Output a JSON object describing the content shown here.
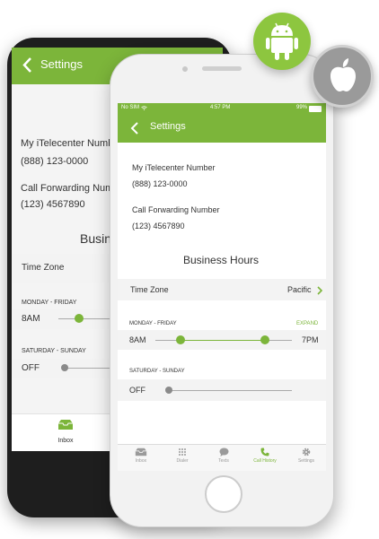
{
  "colors": {
    "brand_green": "#7cb53a",
    "accent_text_green": "#7cb53a",
    "text_dark": "#333333"
  },
  "badges": {
    "android": "android-icon",
    "apple": "apple-icon"
  },
  "android": {
    "header_title": "Settings",
    "number_label": "My iTelecenter Numb",
    "number_value": "(888) 123-0000",
    "forward_label": "Call Forwarding Num",
    "forward_value": "(123) 4567890",
    "business_heading": "Busin",
    "timezone_label": "Time Zone",
    "weekday_label": "MONDAY  -  FRIDAY",
    "weekday_start": "8AM",
    "weekend_label": "SATURDAY - SUNDAY",
    "weekend_state": "OFF",
    "tab_label": "Inbox"
  },
  "iphone": {
    "status": {
      "carrier": "No SIM",
      "time": "4:57 PM",
      "battery": "99%"
    },
    "header_title": "Settings",
    "number_label": "My iTelecenter Number",
    "number_value": "(888) 123-0000",
    "forward_label": "Call Forwarding Number",
    "forward_value": "(123) 4567890",
    "business_heading": "Business Hours",
    "timezone_label": "Time Zone",
    "timezone_value": "Pacific",
    "weekday_label": "MONDAY  -  FRIDAY",
    "expand_label": "EXPAND",
    "weekday_start": "8AM",
    "weekday_end": "7PM",
    "weekend_label": "SATURDAY - SUNDAY",
    "weekend_state": "OFF",
    "tabs": [
      {
        "label": "Inbox",
        "icon": "inbox-icon"
      },
      {
        "label": "Dialer",
        "icon": "dialpad-icon"
      },
      {
        "label": "Texts",
        "icon": "chat-bubble-icon"
      },
      {
        "label": "Call History",
        "icon": "phone-icon"
      },
      {
        "label": "Settings",
        "icon": "gear-icon"
      }
    ],
    "active_tab": "Call History"
  }
}
